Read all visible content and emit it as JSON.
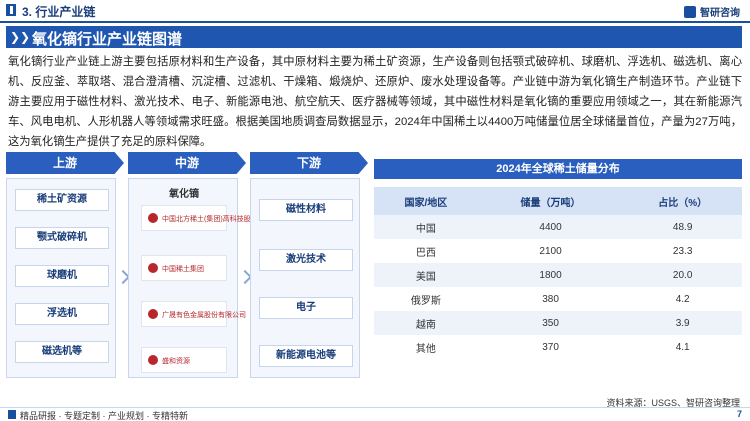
{
  "header": {
    "section": "3. 行业产业链",
    "brand": "智研咨询"
  },
  "title": "氧化镝行业产业链图谱",
  "description": "氧化镝行业产业链上游主要包括原材料和生产设备，其中原材料主要为稀土矿资源，生产设备则包括颚式破碎机、球磨机、浮选机、磁选机、离心机、反应釜、萃取塔、混合澄清槽、沉淀槽、过滤机、干燥箱、煅烧炉、还原炉、废水处理设备等。产业链中游为氧化镝生产制造环节。产业链下游主要应用于磁性材料、激光技术、电子、新能源电池、航空航天、医疗器械等领域，其中磁性材料是氧化镝的重要应用领域之一，其在新能源汽车、风电电机、人形机器人等领域需求旺盛。根据美国地质调查局数据显示，2024年中国稀土以4400万吨储量位居全球储量首位，产量为27万吨，这为氧化镝生产提供了充足的原料保障。",
  "chain": {
    "upstream": {
      "label": "上游",
      "items": [
        "稀土矿资源",
        "颚式破碎机",
        "球磨机",
        "浮选机",
        "磁选机等"
      ]
    },
    "midstream": {
      "label": "中游",
      "product": "氧化镝",
      "companies": [
        "中国北方稀土(集团)高科技股份有限公司",
        "中国稀土集团",
        "广晟有色金属股份有限公司",
        "盛和资源"
      ]
    },
    "downstream": {
      "label": "下游",
      "items": [
        "磁性材料",
        "激光技术",
        "电子",
        "新能源电池等"
      ]
    }
  },
  "table": {
    "title": "2024年全球稀土储量分布",
    "headers": [
      "国家/地区",
      "储量（万吨）",
      "占比（%）"
    ],
    "rows": [
      [
        "中国",
        "4400",
        "48.9"
      ],
      [
        "巴西",
        "2100",
        "23.3"
      ],
      [
        "美国",
        "1800",
        "20.0"
      ],
      [
        "俄罗斯",
        "380",
        "4.2"
      ],
      [
        "越南",
        "350",
        "3.9"
      ],
      [
        "其他",
        "370",
        "4.1"
      ]
    ],
    "source": "资料来源：USGS、智研咨询整理"
  },
  "footer": {
    "text": "精品研报 · 专题定制 · 产业规划 · 专精特新",
    "page": "7"
  },
  "colors": {
    "primary": "#1e56b0",
    "header_text": "#1a3e7a",
    "table_stripe": "#eef3fb"
  }
}
